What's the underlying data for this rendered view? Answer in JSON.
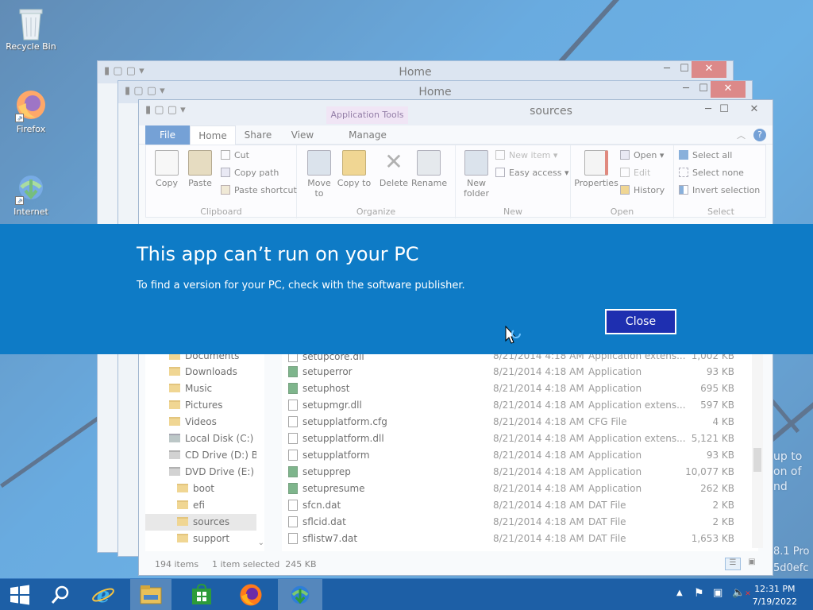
{
  "desktop": {
    "icons": [
      {
        "label": "Recycle Bin"
      },
      {
        "label": "Firefox"
      },
      {
        "label": "Internet"
      }
    ],
    "side_text": [
      "up to",
      "on of",
      "nd"
    ],
    "watermark": [
      "8.1 Pro",
      "5d0efc"
    ]
  },
  "windows": {
    "back1_title": "Home",
    "back2_title": "Home",
    "main_title": "sources"
  },
  "ribbon": {
    "app_tools": "Application Tools",
    "tabs": {
      "file": "File",
      "home": "Home",
      "share": "Share",
      "view": "View",
      "manage": "Manage"
    },
    "clipboard": {
      "copy": "Copy",
      "paste": "Paste",
      "cut": "Cut",
      "copy_path": "Copy path",
      "paste_shortcut": "Paste shortcut",
      "label": "Clipboard"
    },
    "organize": {
      "move_to": "Move to",
      "copy_to": "Copy to",
      "delete": "Delete",
      "rename": "Rename",
      "label": "Organize"
    },
    "new": {
      "new_folder": "New folder",
      "new_item": "New item",
      "easy_access": "Easy access",
      "label": "New"
    },
    "open": {
      "properties": "Properties",
      "open": "Open",
      "edit": "Edit",
      "history": "History",
      "label": "Open"
    },
    "select": {
      "select_all": "Select all",
      "select_none": "Select none",
      "invert": "Invert selection",
      "label": "Select"
    }
  },
  "nav": [
    {
      "label": "Documents"
    },
    {
      "label": "Downloads"
    },
    {
      "label": "Music"
    },
    {
      "label": "Pictures"
    },
    {
      "label": "Videos"
    },
    {
      "label": "Local Disk (C:)"
    },
    {
      "label": "CD Drive (D:) Bor"
    },
    {
      "label": "DVD Drive (E:) JM"
    },
    {
      "label": "boot"
    },
    {
      "label": "efi"
    },
    {
      "label": "sources"
    },
    {
      "label": "support"
    }
  ],
  "files": [
    {
      "name": "setupcore.dll",
      "date": "8/21/2014 4:18 AM",
      "type": "Application extens...",
      "size": "1,002 KB"
    },
    {
      "name": "setuperror",
      "date": "8/21/2014 4:18 AM",
      "type": "Application",
      "size": "93 KB"
    },
    {
      "name": "setuphost",
      "date": "8/21/2014 4:18 AM",
      "type": "Application",
      "size": "695 KB"
    },
    {
      "name": "setupmgr.dll",
      "date": "8/21/2014 4:18 AM",
      "type": "Application extens...",
      "size": "597 KB"
    },
    {
      "name": "setupplatform.cfg",
      "date": "8/21/2014 4:18 AM",
      "type": "CFG File",
      "size": "4 KB"
    },
    {
      "name": "setupplatform.dll",
      "date": "8/21/2014 4:18 AM",
      "type": "Application extens...",
      "size": "5,121 KB"
    },
    {
      "name": "setupplatform",
      "date": "8/21/2014 4:18 AM",
      "type": "Application",
      "size": "93 KB"
    },
    {
      "name": "setupprep",
      "date": "8/21/2014 4:18 AM",
      "type": "Application",
      "size": "10,077 KB"
    },
    {
      "name": "setupresume",
      "date": "8/21/2014 4:18 AM",
      "type": "Application",
      "size": "262 KB"
    },
    {
      "name": "sfcn.dat",
      "date": "8/21/2014 4:18 AM",
      "type": "DAT File",
      "size": "2 KB"
    },
    {
      "name": "sflcid.dat",
      "date": "8/21/2014 4:18 AM",
      "type": "DAT File",
      "size": "2 KB"
    },
    {
      "name": "sflistw7.dat",
      "date": "8/21/2014 4:18 AM",
      "type": "DAT File",
      "size": "1,653 KB"
    }
  ],
  "status": {
    "items": "194 items",
    "selected": "1 item selected  245 KB"
  },
  "dialog": {
    "title": "This app can’t run on your PC",
    "message": "To find a version for your PC, check with the software publisher.",
    "close": "Close"
  },
  "taskbar": {
    "time": "12:31 PM",
    "date": "7/19/2022"
  },
  "colors": {
    "dialog_bg": "#0e7bc6",
    "close_btn": "#1e2fb0",
    "taskbar": "#1d5fa6"
  }
}
